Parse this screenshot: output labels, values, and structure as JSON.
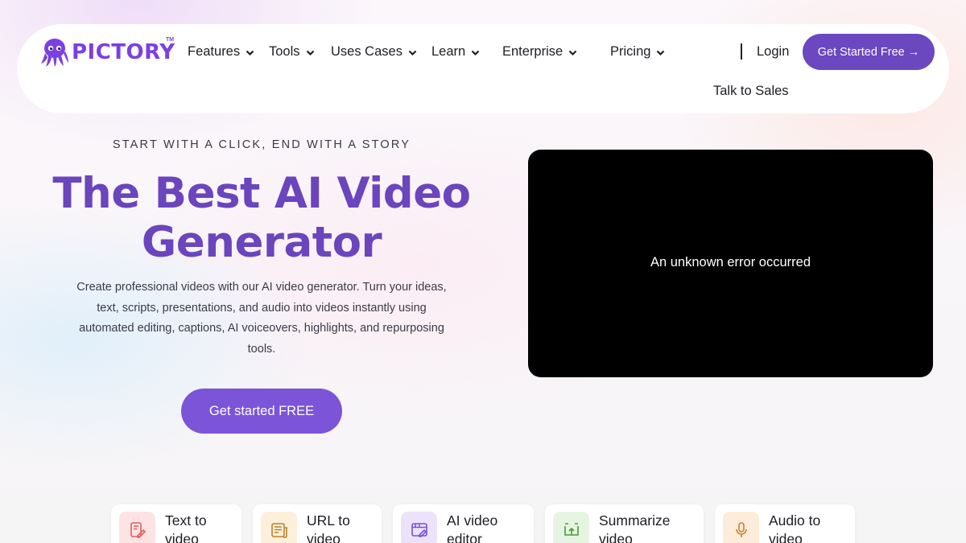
{
  "brand": {
    "name": "PICTORY",
    "tm": "TM",
    "color": "#7b3fe4"
  },
  "nav": {
    "items": [
      {
        "label": "Features"
      },
      {
        "label": "Tools"
      },
      {
        "label": "Uses Cases"
      },
      {
        "label": "Learn"
      },
      {
        "label": "Enterprise"
      },
      {
        "label": "Pricing"
      }
    ],
    "login": "Login",
    "cta": "Get Started Free →",
    "talk_to_sales": "Talk to Sales"
  },
  "hero": {
    "eyebrow": "START WITH A CLICK, END WITH A STORY",
    "headline": "The Best AI Video Generator",
    "subtitle": "Create professional videos with our AI video generator. Turn your ideas, text, scripts, presentations, and audio into videos instantly using automated editing, captions, AI voiceovers, highlights, and repurposing tools.",
    "cta": "Get started FREE",
    "accent": "#6a45bd"
  },
  "video": {
    "error": "An unknown error occurred"
  },
  "tools": [
    {
      "label": "Text to video",
      "icon": "text-to-video-icon",
      "bg": "#fde3e3",
      "color": "#e0605e"
    },
    {
      "label": "URL to video",
      "icon": "url-to-video-icon",
      "bg": "#fdf0da",
      "color": "#b8822a"
    },
    {
      "label": "AI video editor",
      "icon": "video-editor-icon",
      "bg": "#ece3fb",
      "color": "#7a52d4"
    },
    {
      "label": "Summarize video",
      "icon": "summarize-video-icon",
      "bg": "#e6f5e1",
      "color": "#4a9a3c"
    },
    {
      "label": "Audio to video",
      "icon": "microphone-icon",
      "bg": "#fdecd9",
      "color": "#c9822e"
    }
  ]
}
